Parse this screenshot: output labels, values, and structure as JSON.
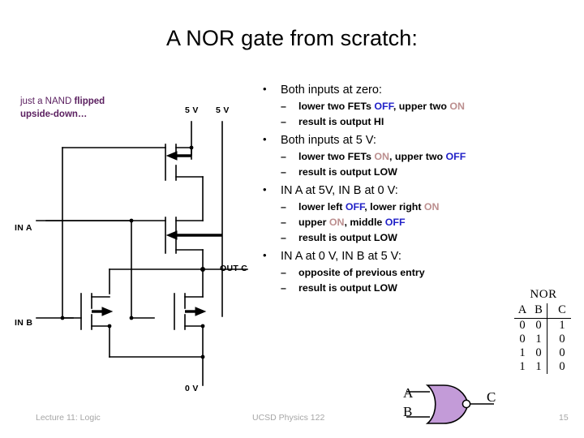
{
  "title": "A NOR gate from scratch:",
  "annotation": {
    "line1_plain": "just a NAND ",
    "line1_bold": "flipped",
    "line2": "upside-down…"
  },
  "bullets": [
    {
      "level1": "Both inputs at zero:",
      "subs": [
        {
          "pre": "lower two FETs ",
          "state1": "OFF",
          "state1_kind": "off",
          "mid": ", upper two ",
          "state2": "ON",
          "state2_kind": "on",
          "post": ""
        },
        {
          "pre": "result is output HI",
          "state1": "",
          "state1_kind": "",
          "mid": "",
          "state2": "",
          "state2_kind": "",
          "post": ""
        }
      ]
    },
    {
      "level1": "Both inputs at 5 V:",
      "subs": [
        {
          "pre": "lower two FETs ",
          "state1": "ON",
          "state1_kind": "on",
          "mid": ", upper two ",
          "state2": "OFF",
          "state2_kind": "off",
          "post": ""
        },
        {
          "pre": "result is output LOW",
          "state1": "",
          "state1_kind": "",
          "mid": "",
          "state2": "",
          "state2_kind": "",
          "post": ""
        }
      ]
    },
    {
      "level1": "IN A at 5V, IN B at 0 V:",
      "subs": [
        {
          "pre": "lower left ",
          "state1": "OFF",
          "state1_kind": "off",
          "mid": ", lower right ",
          "state2": "ON",
          "state2_kind": "on",
          "post": ""
        },
        {
          "pre": "upper ",
          "state1": "ON",
          "state1_kind": "on",
          "mid": ", middle ",
          "state2": "OFF",
          "state2_kind": "off",
          "post": ""
        },
        {
          "pre": "result is output LOW",
          "state1": "",
          "state1_kind": "",
          "mid": "",
          "state2": "",
          "state2_kind": "",
          "post": ""
        }
      ]
    },
    {
      "level1": "IN A at 0 V, IN B at 5 V:",
      "subs": [
        {
          "pre": "opposite of previous entry",
          "state1": "",
          "state1_kind": "",
          "mid": "",
          "state2": "",
          "state2_kind": "",
          "post": ""
        },
        {
          "pre": "result is output LOW",
          "state1": "",
          "state1_kind": "",
          "mid": "",
          "state2": "",
          "state2_kind": "",
          "post": ""
        }
      ]
    }
  ],
  "circuit": {
    "supply_left_label": "5 V",
    "supply_right_label": "5 V",
    "input_a_label": "IN A",
    "input_b_label": "IN B",
    "output_label": "OUT C",
    "ground_label": "0 V"
  },
  "truth_table": {
    "name": "NOR",
    "headers": [
      "A",
      "B",
      "C"
    ],
    "rows": [
      {
        "a": "0",
        "b": "0",
        "c": "1"
      },
      {
        "a": "0",
        "b": "1",
        "c": "0"
      },
      {
        "a": "1",
        "b": "0",
        "c": "0"
      },
      {
        "a": "1",
        "b": "1",
        "c": "0"
      }
    ]
  },
  "gate_symbol": {
    "input_a": "A",
    "input_b": "B",
    "output": "C",
    "fill_color": "#c39bd8"
  },
  "footer": {
    "left": "Lecture 11: Logic",
    "center": "UCSD Physics 122",
    "page": "15"
  },
  "colors": {
    "annotation": "#5b2060",
    "on": "#bc8f8f",
    "off": "#2121c8",
    "footer": "#a6a6a6"
  }
}
